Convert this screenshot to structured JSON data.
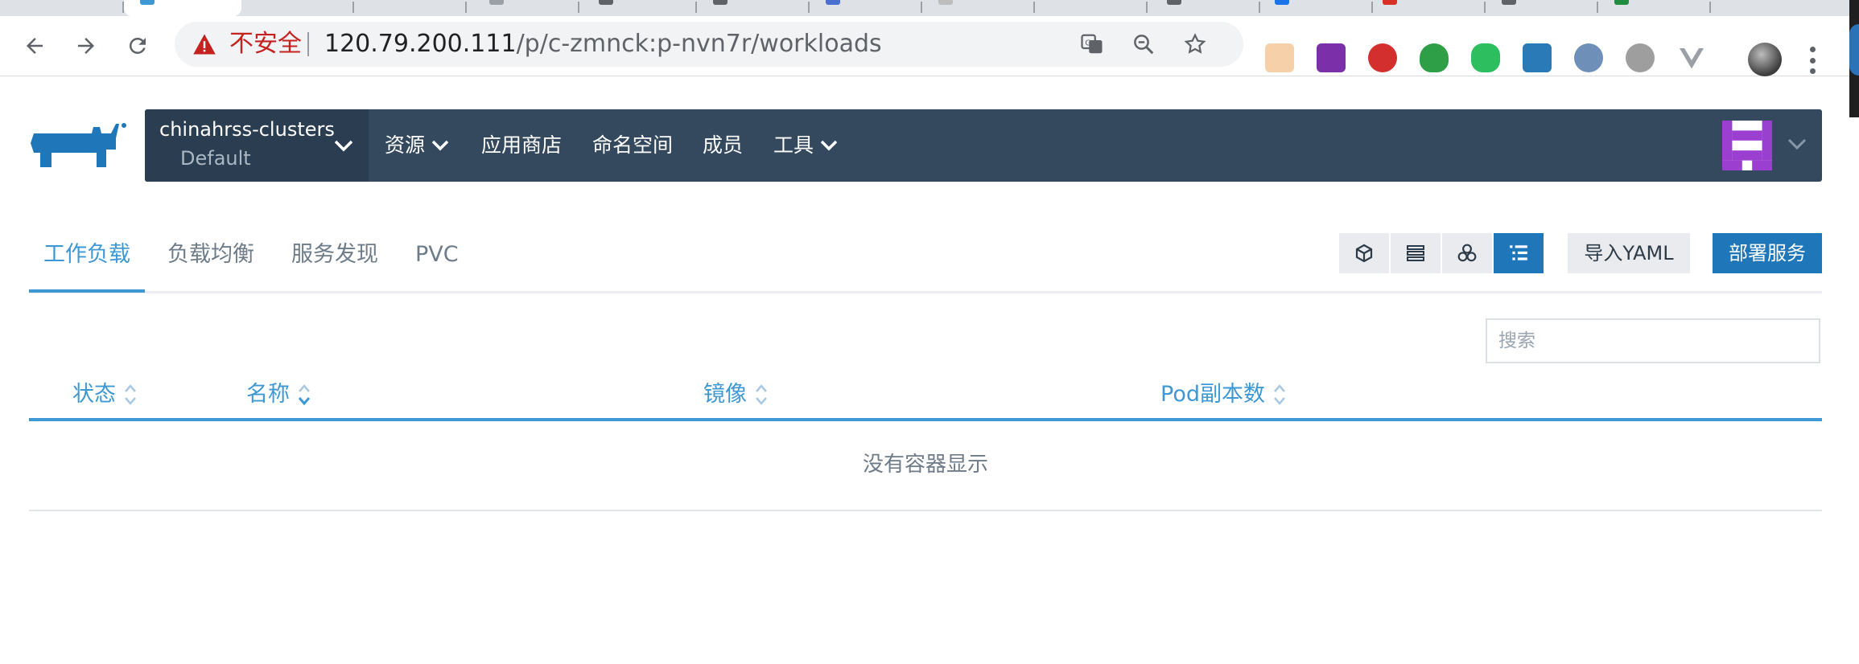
{
  "browser": {
    "security_label": "不安全",
    "url_host": "120.79.200.111",
    "url_path": "/p/c-zmnck:p-nvn7r/workloads"
  },
  "header": {
    "cluster_name": "chinahrss-clusters",
    "project_name": "Default",
    "menu": {
      "resources": "资源",
      "app_store": "应用商店",
      "namespaces": "命名空间",
      "members": "成员",
      "tools": "工具"
    }
  },
  "tabs": {
    "workloads": "工作负载",
    "load_balancing": "负载均衡",
    "service_discovery": "服务发现",
    "pvc": "PVC"
  },
  "actions": {
    "import_yaml": "导入YAML",
    "deploy": "部署服务"
  },
  "search": {
    "placeholder": "搜索"
  },
  "table": {
    "columns": {
      "state": "状态",
      "name": "名称",
      "image": "镜像",
      "pod_replicas": "Pod副本数"
    },
    "empty_message": "没有容器显示"
  },
  "colors": {
    "header_bg": "#34495e",
    "accent": "#3d98d3",
    "primary_button": "#1f76b8"
  }
}
